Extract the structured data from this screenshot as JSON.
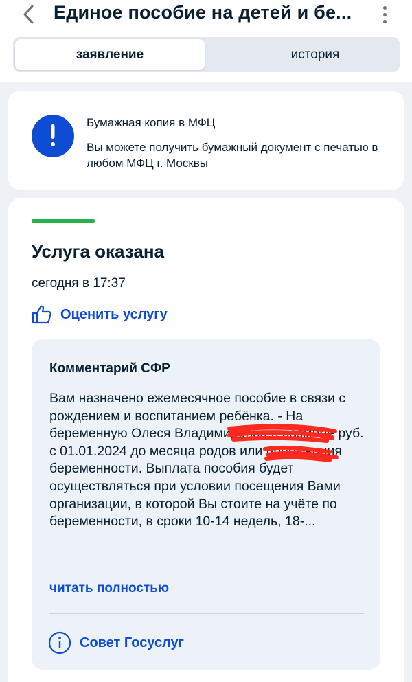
{
  "header": {
    "title": "Единое пособие на детей и бе..."
  },
  "tabs": [
    {
      "label": "заявление",
      "active": true
    },
    {
      "label": "история",
      "active": false
    }
  ],
  "notice": {
    "title": "Бумажная копия в МФЦ",
    "text": "Вы можете получить бумажный документ с печатью в любом МФЦ г. Москвы",
    "icon": "exclamation-icon"
  },
  "status": {
    "title": "Услуга оказана",
    "date": "сегодня в 17:37",
    "rate_label": "Оценить услугу",
    "bar_color": "#25b34a"
  },
  "comment": {
    "title": "Комментарий СФР",
    "text": "Вам назначено ежемесячное пособие в связи с рождением и воспитанием ребёнка. - На беременную                 Олеся Владимировна в размере           руб. с 01.01.2024 до месяца родов или прерывания беременности. Выплата пособия будет осуществляться при условии посещения Вами организации, в которой Вы стоите на учёте по беременности, в сроки 10-14 недель, 18-...",
    "read_more": "читать полностью",
    "advice_label": "Совет Госуслуг"
  },
  "colors": {
    "accent": "#0d4cd3",
    "success": "#25b34a",
    "background": "#eef1f6",
    "comment_bg": "#edf2f8"
  }
}
